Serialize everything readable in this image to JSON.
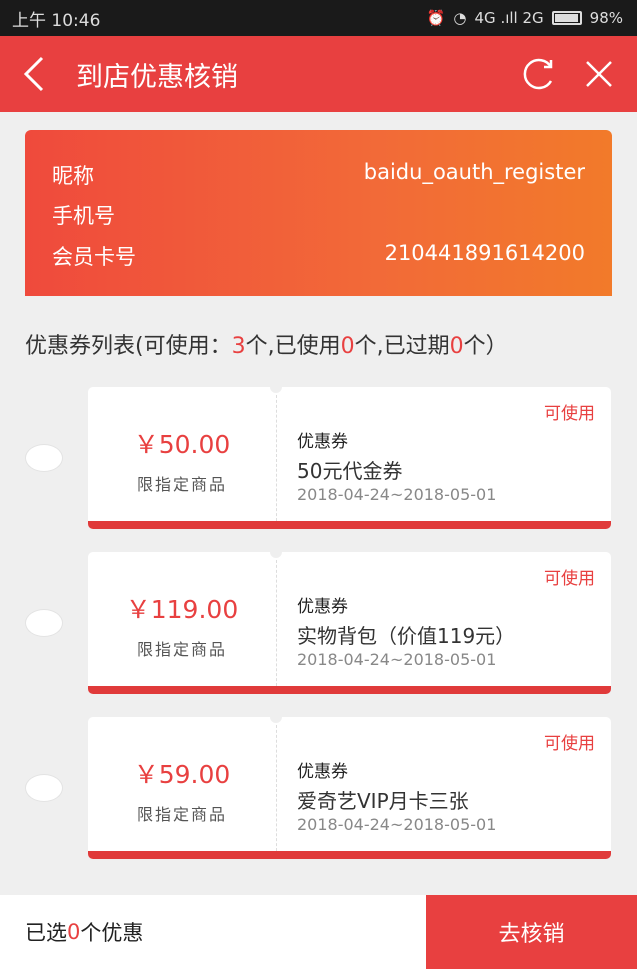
{
  "status_bar": {
    "time": "上午 10:46",
    "network": "4G .ıll 2G",
    "battery": "98%"
  },
  "nav": {
    "title": "到店优惠核销"
  },
  "member": {
    "nickname_label": "昵称",
    "nickname_value": "baidu_oauth_register",
    "phone_label": "手机号",
    "phone_value": "",
    "card_label": "会员卡号",
    "card_value": "210441891614200"
  },
  "summary": {
    "prefix": "优惠券列表(可使用：",
    "available": "3",
    "mid1": "个,已使用",
    "used": "0",
    "mid2": "个,已过期",
    "expired": "0",
    "suffix": "个）"
  },
  "coupons": [
    {
      "price": "￥50.00",
      "limit": "限指定商品",
      "status": "可使用",
      "type": "优惠券",
      "name": "50元代金券",
      "date": "2018-04-24~2018-05-01"
    },
    {
      "price": "￥119.00",
      "limit": "限指定商品",
      "status": "可使用",
      "type": "优惠券",
      "name": "实物背包（价值119元）",
      "date": "2018-04-24~2018-05-01"
    },
    {
      "price": "￥59.00",
      "limit": "限指定商品",
      "status": "可使用",
      "type": "优惠券",
      "name": "爱奇艺VIP月卡三张",
      "date": "2018-04-24~2018-05-01"
    }
  ],
  "bottom": {
    "prefix": "已选",
    "count": "0",
    "suffix": "个优惠",
    "submit_label": "去核销"
  },
  "colors": {
    "accent": "#e84040"
  }
}
